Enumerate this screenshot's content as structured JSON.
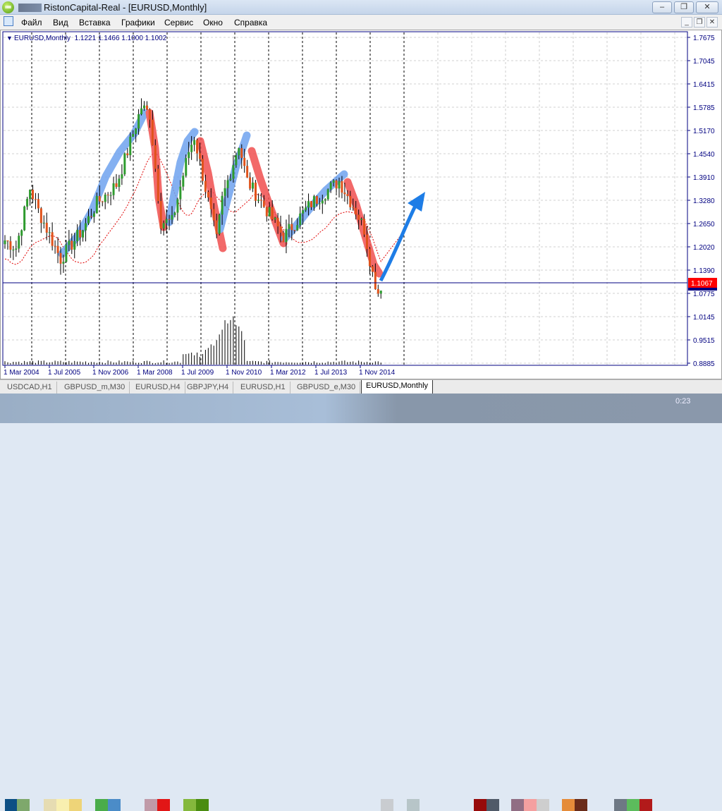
{
  "window": {
    "title": "RistonCapital-Real - [EURUSD,Monthly]",
    "min": "–",
    "max": "❐",
    "close": "✕"
  },
  "menu": [
    "Файл",
    "Вид",
    "Вставка",
    "Графики",
    "Сервис",
    "Окно",
    "Справка"
  ],
  "chart": {
    "info": "EURUSD,Monthly  1.1221 1.1466 1.1000 1.1002",
    "price_labels": [
      "1.7675",
      "1.7045",
      "1.6415",
      "1.5785",
      "1.5170",
      "1.4540",
      "1.3910",
      "1.3280",
      "1.2650",
      "1.2020",
      "1.1390",
      "1.0775",
      "1.0145",
      "0.9515",
      "0.8885"
    ],
    "current_price": "1.1067",
    "time_labels": [
      "1 Mar 2004",
      "1 Jul 2005",
      "1 Nov 2006",
      "1 Mar 2008",
      "1 Jul 2009",
      "1 Nov 2010",
      "1 Mar 2012",
      "1 Jul 2013",
      "1 Nov 2014"
    ],
    "colors": {
      "bull": "#2e9b2e",
      "bear": "#e0521a",
      "axis": "#000080",
      "ma": "#e00000",
      "highlight_up": "#6fa3ef",
      "highlight_down": "#f05050",
      "arrow": "#1e7de6"
    }
  },
  "chart_data": {
    "type": "candlestick",
    "title": "EURUSD,Monthly",
    "ylim": [
      0.8885,
      1.7675
    ],
    "anchors_month_close": [
      [
        0,
        1.22
      ],
      [
        4,
        1.2
      ],
      [
        9,
        1.36
      ],
      [
        12,
        1.3
      ],
      [
        20,
        1.17
      ],
      [
        28,
        1.25
      ],
      [
        33,
        1.32
      ],
      [
        40,
        1.37
      ],
      [
        44,
        1.46
      ],
      [
        49,
        1.58
      ],
      [
        52,
        1.56
      ],
      [
        56,
        1.27
      ],
      [
        60,
        1.27
      ],
      [
        66,
        1.46
      ],
      [
        68,
        1.5
      ],
      [
        76,
        1.22
      ],
      [
        78,
        1.33
      ],
      [
        84,
        1.48
      ],
      [
        87,
        1.38
      ],
      [
        95,
        1.29
      ],
      [
        100,
        1.23
      ],
      [
        110,
        1.32
      ],
      [
        120,
        1.38
      ],
      [
        126,
        1.3
      ],
      [
        129,
        1.25
      ],
      [
        132,
        1.13
      ],
      [
        134,
        1.08
      ],
      [
        135,
        1.1
      ]
    ]
  },
  "tabs": [
    "USDCAD,H1",
    "GBPUSD_m,M30",
    "EURUSD,H4",
    "GBPJPY,H4",
    "EURUSD,H1",
    "GBPUSD_e,M30",
    "EURUSD,Monthly"
  ],
  "taskbar": {
    "clock": "0:23"
  }
}
